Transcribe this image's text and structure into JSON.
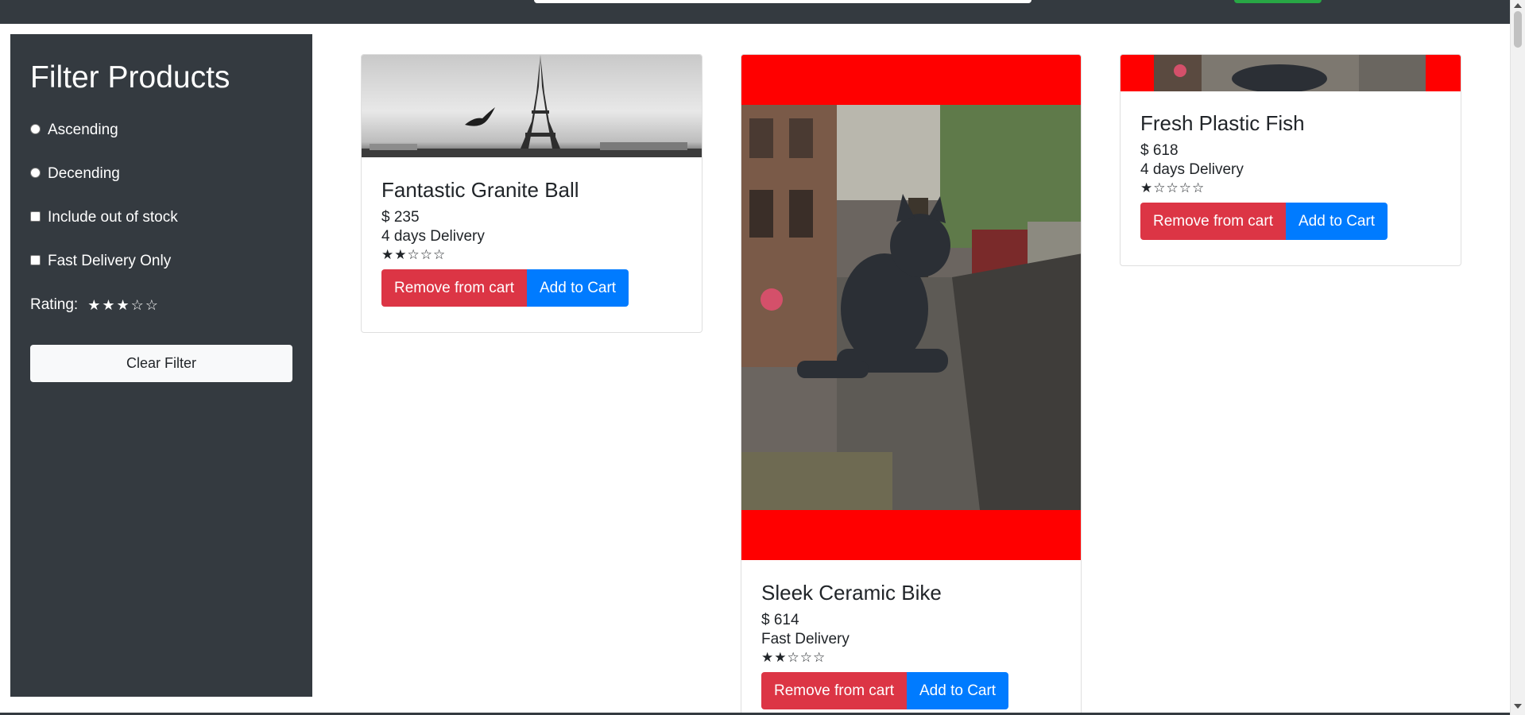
{
  "filters": {
    "title": "Filter Products",
    "sort_ascending": "Ascending",
    "sort_descending": "Decending",
    "include_out_of_stock": "Include out of stock",
    "fast_delivery_only": "Fast Delivery Only",
    "rating_label": "Rating:",
    "rating_value": 3,
    "rating_max": 5,
    "clear_button": "Clear Filter"
  },
  "products": [
    {
      "name": "Fantastic Granite Ball",
      "price": "$ 235",
      "delivery": "4 days Delivery",
      "rating": 2,
      "remove_label": "Remove from cart",
      "add_label": "Add to Cart"
    },
    {
      "name": "Sleek Ceramic Bike",
      "price": "$ 614",
      "delivery": "Fast Delivery",
      "rating": 2,
      "remove_label": "Remove from cart",
      "add_label": "Add to Cart"
    },
    {
      "name": "Fresh Plastic Fish",
      "price": "$ 618",
      "delivery": "4 days Delivery",
      "rating": 1,
      "remove_label": "Remove from cart",
      "add_label": "Add to Cart"
    }
  ],
  "colors": {
    "sidebar_bg": "#343a40",
    "remove_button": "#dc3545",
    "add_button": "#007bff",
    "image_letterbox": "#ff0000"
  }
}
